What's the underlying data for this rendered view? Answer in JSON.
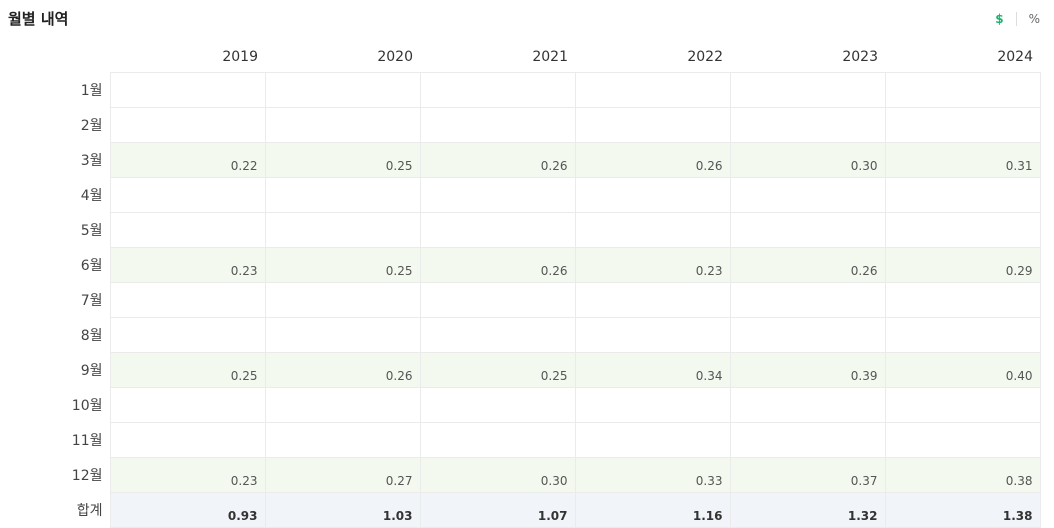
{
  "title": "월별 내역",
  "toggle": {
    "dollar": "$",
    "percent": "%",
    "active": "dollar",
    "active_color": "#1bb36b"
  },
  "years": [
    "2019",
    "2020",
    "2021",
    "2022",
    "2023",
    "2024"
  ],
  "rows": [
    {
      "label": "1월",
      "values": [
        "",
        "",
        "",
        "",
        "",
        ""
      ]
    },
    {
      "label": "2월",
      "values": [
        "",
        "",
        "",
        "",
        "",
        ""
      ]
    },
    {
      "label": "3월",
      "values": [
        "0.22",
        "0.25",
        "0.26",
        "0.26",
        "0.30",
        "0.31"
      ]
    },
    {
      "label": "4월",
      "values": [
        "",
        "",
        "",
        "",
        "",
        ""
      ]
    },
    {
      "label": "5월",
      "values": [
        "",
        "",
        "",
        "",
        "",
        ""
      ]
    },
    {
      "label": "6월",
      "values": [
        "0.23",
        "0.25",
        "0.26",
        "0.23",
        "0.26",
        "0.29"
      ]
    },
    {
      "label": "7월",
      "values": [
        "",
        "",
        "",
        "",
        "",
        ""
      ]
    },
    {
      "label": "8월",
      "values": [
        "",
        "",
        "",
        "",
        "",
        ""
      ]
    },
    {
      "label": "9월",
      "values": [
        "0.25",
        "0.26",
        "0.25",
        "0.34",
        "0.39",
        "0.40"
      ]
    },
    {
      "label": "10월",
      "values": [
        "",
        "",
        "",
        "",
        "",
        ""
      ]
    },
    {
      "label": "11월",
      "values": [
        "",
        "",
        "",
        "",
        "",
        ""
      ]
    },
    {
      "label": "12월",
      "values": [
        "0.23",
        "0.27",
        "0.30",
        "0.33",
        "0.37",
        "0.38"
      ]
    }
  ],
  "total": {
    "label": "합계",
    "values": [
      "0.93",
      "1.03",
      "1.07",
      "1.16",
      "1.32",
      "1.38"
    ]
  }
}
